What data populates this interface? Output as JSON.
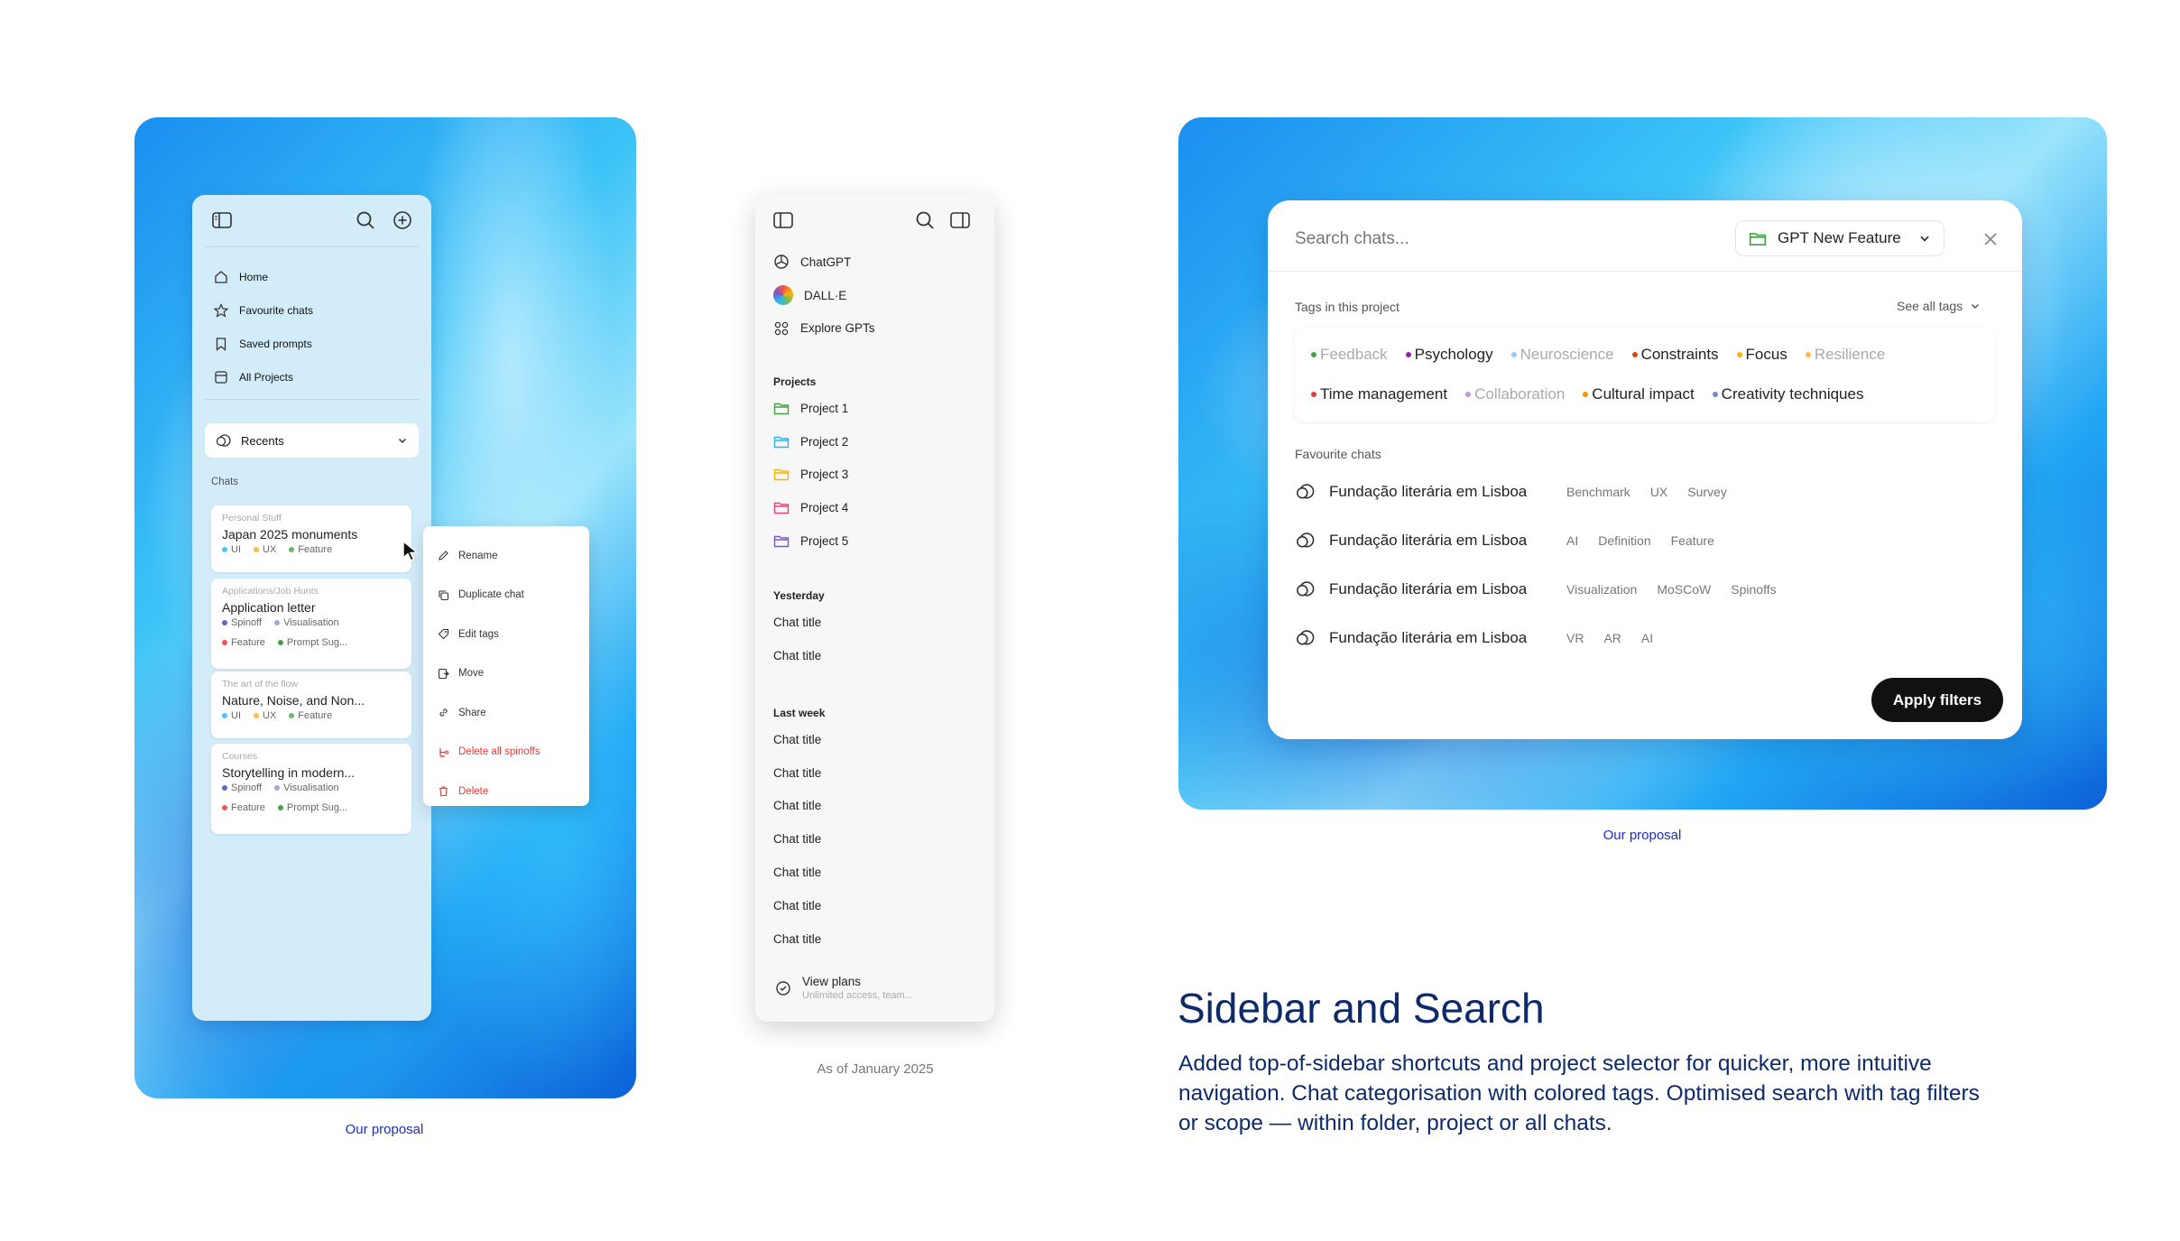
{
  "left": {
    "caption": "Our proposal",
    "nav": [
      "Home",
      "Favourite chats",
      "Saved prompts",
      "All Projects"
    ],
    "recents_label": "Recents",
    "chats_label": "Chats",
    "cards": [
      {
        "group": "Personal Stuff",
        "title": "Japan 2025 monuments",
        "tags": [
          {
            "t": "UI",
            "c": "#4fc3f7"
          },
          {
            "t": "UX",
            "c": "#ffb74d"
          },
          {
            "t": "Feature",
            "c": "#66bb6a"
          }
        ]
      },
      {
        "group": "Applications/Job Hunts",
        "title": "Application letter",
        "tags": [
          {
            "t": "Spinoff",
            "c": "#5c6bc0"
          },
          {
            "t": "Visualisation",
            "c": "#9fa8da"
          }
        ],
        "tags2": [
          {
            "t": "Feature",
            "c": "#ef5350"
          },
          {
            "t": "Prompt Sug...",
            "c": "#43a047"
          }
        ]
      },
      {
        "group": "The art of the flow",
        "title": "Nature, Noise, and Non...",
        "tags": [
          {
            "t": "UI",
            "c": "#4fc3f7"
          },
          {
            "t": "UX",
            "c": "#ffb74d"
          },
          {
            "t": "Feature",
            "c": "#66bb6a"
          }
        ]
      },
      {
        "group": "Courses",
        "title": "Storytelling in modern...",
        "tags": [
          {
            "t": "Spinoff",
            "c": "#5c6bc0"
          },
          {
            "t": "Visualisation",
            "c": "#9fa8da"
          }
        ],
        "tags2": [
          {
            "t": "Feature",
            "c": "#ef5350"
          },
          {
            "t": "Prompt Sug...",
            "c": "#43a047"
          }
        ]
      }
    ],
    "context_menu": [
      "Rename",
      "Duplicate chat",
      "Edit tags",
      "Move",
      "Share",
      "Delete all spinoffs",
      "Delete"
    ]
  },
  "middle": {
    "caption": "As of January 2025",
    "apps": [
      "ChatGPT",
      "DALL·E",
      "Explore GPTs"
    ],
    "projects_label": "Projects",
    "projects": [
      {
        "name": "Project 1",
        "color": "#43a047"
      },
      {
        "name": "Project 2",
        "color": "#29b6f6"
      },
      {
        "name": "Project 3",
        "color": "#ffb300"
      },
      {
        "name": "Project 4",
        "color": "#ec407a"
      },
      {
        "name": "Project 5",
        "color": "#7e57c2"
      }
    ],
    "yesterday_label": "Yesterday",
    "yesterday": [
      "Chat title",
      "Chat title"
    ],
    "lastweek_label": "Last week",
    "lastweek": [
      "Chat title",
      "Chat title",
      "Chat title",
      "Chat title",
      "Chat title",
      "Chat title",
      "Chat title"
    ],
    "view_plans": "View plans",
    "view_plans_sub": "Unlimited access, team..."
  },
  "right": {
    "caption": "Our proposal",
    "search_placeholder": "Search chats...",
    "scope": "GPT New Feature",
    "tags_label": "Tags in this project",
    "see_all": "See all tags",
    "tags_row1": [
      {
        "t": "Feedback",
        "c": "#43a047",
        "dim": true
      },
      {
        "t": "Psychology",
        "c": "#8e24aa",
        "dim": false
      },
      {
        "t": "Neuroscience",
        "c": "#90caf9",
        "dim": true
      },
      {
        "t": "Constraints",
        "c": "#d84315",
        "dim": false
      },
      {
        "t": "Focus",
        "c": "#ffb300",
        "dim": false
      },
      {
        "t": "Resilience",
        "c": "#ffb74d",
        "dim": true
      }
    ],
    "tags_row2": [
      {
        "t": "Time management",
        "c": "#e53935",
        "dim": false
      },
      {
        "t": "Collaboration",
        "c": "#ce93d8",
        "dim": true
      },
      {
        "t": "Cultural impact",
        "c": "#ff8f00",
        "dim": false
      },
      {
        "t": "Creativity techniques",
        "c": "#7986cb",
        "dim": false
      }
    ],
    "fav_label": "Favourite chats",
    "favs": [
      {
        "title": "Fundação literária em Lisboa",
        "tags": [
          "Benchmark",
          "UX",
          "Survey"
        ]
      },
      {
        "title": "Fundação literária em Lisboa",
        "tags": [
          "AI",
          "Definition",
          "Feature"
        ]
      },
      {
        "title": "Fundação literária em Lisboa",
        "tags": [
          "Visualization",
          "MoSCoW",
          "Spinoffs"
        ]
      },
      {
        "title": "Fundação literária em Lisboa",
        "tags": [
          "VR",
          "AR",
          "AI"
        ]
      }
    ],
    "apply": "Apply filters"
  },
  "heading": {
    "title": "Sidebar and Search",
    "body": "Added top-of-sidebar shortcuts and project selector for quicker, more intuitive navigation. Chat categorisation with colored tags. Optimised search with tag filters or scope — within folder, project or all chats."
  }
}
